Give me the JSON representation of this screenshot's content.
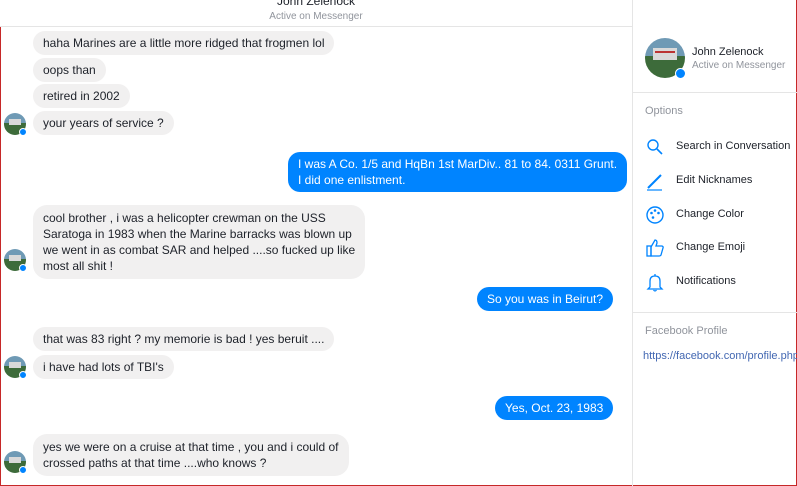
{
  "header": {
    "name": "John Zelenock",
    "status": "Active on Messenger"
  },
  "messages": [
    {
      "text": "haha Marines are a little more ridged that frogmen lol"
    },
    {
      "text": "oops than"
    },
    {
      "text": "retired in 2002"
    },
    {
      "text": "your years of service ?"
    },
    {
      "lines": [
        "I was A Co. 1/5 and HqBn 1st MarDiv.. 81 to 84. 0311 Grunt.",
        "I did one enlistment."
      ]
    },
    {
      "lines": [
        "cool brother , i was a helicopter crewman on the USS",
        "Saratoga in 1983 when the Marine barracks was blown up",
        "we went in as combat SAR and helped ....so fucked up like",
        "most all shit !"
      ]
    },
    {
      "text": "So you was in Beirut?"
    },
    {
      "text": "that was 83 right ?  my memorie is bad !  yes beruit ...."
    },
    {
      "text": "i have had lots of TBI's"
    },
    {
      "text": "Yes, Oct. 23, 1983"
    },
    {
      "lines": [
        "yes we were on a cruise at that time , you and i could of",
        "crossed paths at that time ....who knows ?"
      ]
    }
  ],
  "sidebar": {
    "profile_name": "John Zelenock",
    "profile_status": "Active on Messenger",
    "options_title": "Options",
    "options": [
      {
        "label": "Search in Conversation",
        "icon": "search-icon"
      },
      {
        "label": "Edit Nicknames",
        "icon": "pencil-icon"
      },
      {
        "label": "Change Color",
        "icon": "palette-icon"
      },
      {
        "label": "Change Emoji",
        "icon": "thumbs-up-icon"
      },
      {
        "label": "Notifications",
        "icon": "bell-icon"
      }
    ],
    "facebook_profile_title": "Facebook Profile",
    "facebook_profile_link": "https://facebook.com/profile.php"
  },
  "colors": {
    "accent": "#0084ff",
    "incoming_bubble": "#f1f0f0",
    "frame_border": "#c62828"
  }
}
